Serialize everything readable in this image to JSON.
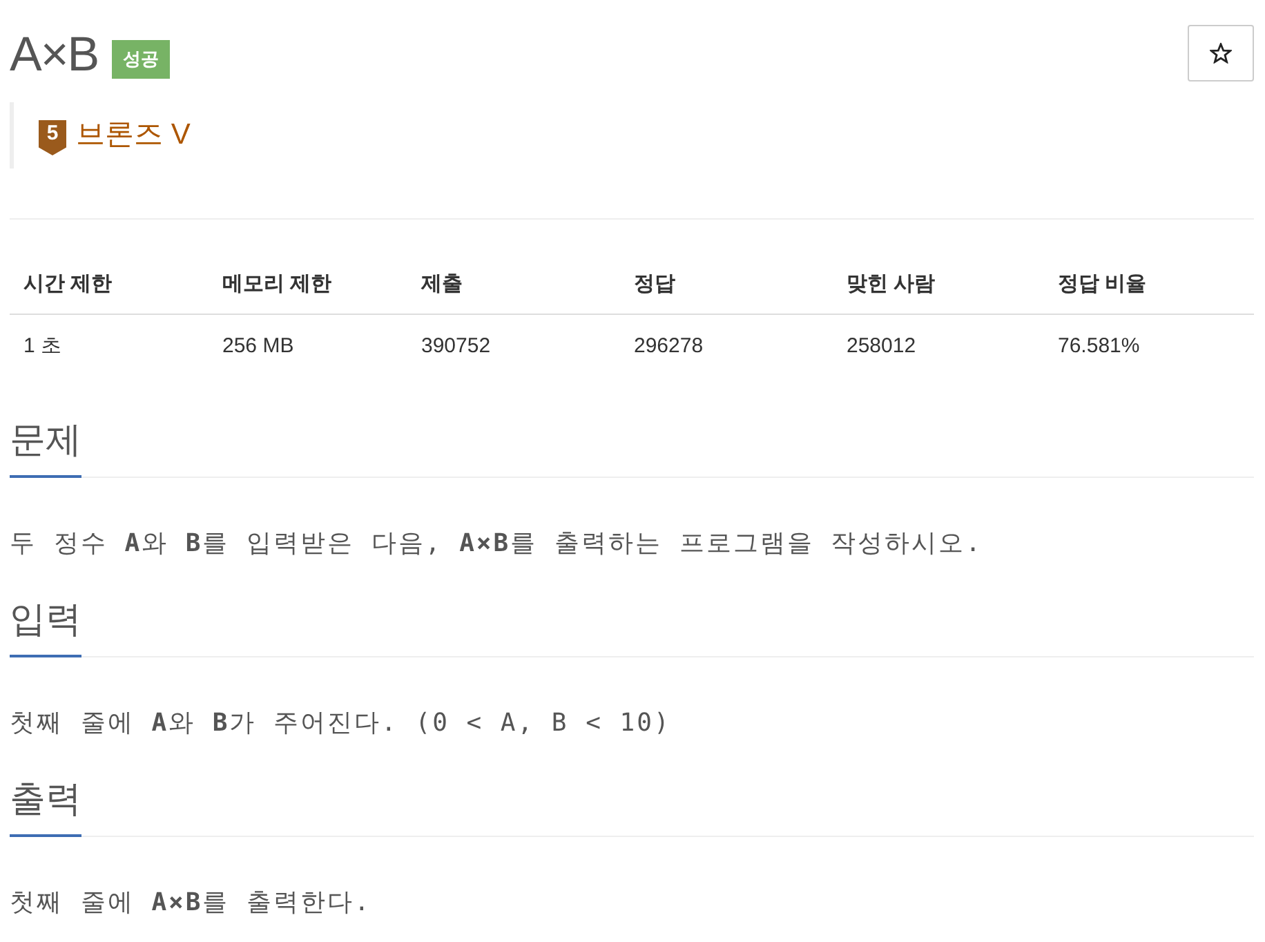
{
  "problem": {
    "title": "A×B",
    "result_badge": "성공",
    "starred": false
  },
  "tier": {
    "number": "5",
    "label": "브론즈 V"
  },
  "stats": {
    "columns": [
      "시간 제한",
      "메모리 제한",
      "제출",
      "정답",
      "맞힌 사람",
      "정답 비율"
    ],
    "rows": [
      [
        "1 초",
        "256 MB",
        "390752",
        "296278",
        "258012",
        "76.581%"
      ]
    ]
  },
  "sections": [
    {
      "heading": "문제",
      "body": "두 정수 **A**와 **B**를 입력받은 다음, **A×B**를 출력하는 프로그램을 작성하시오."
    },
    {
      "heading": "입력",
      "body": "첫째 줄에 **A**와 **B**가 주어진다. (0 < A, B < 10)"
    },
    {
      "heading": "출력",
      "body": "첫째 줄에 **A×B**를 출력한다."
    }
  ]
}
